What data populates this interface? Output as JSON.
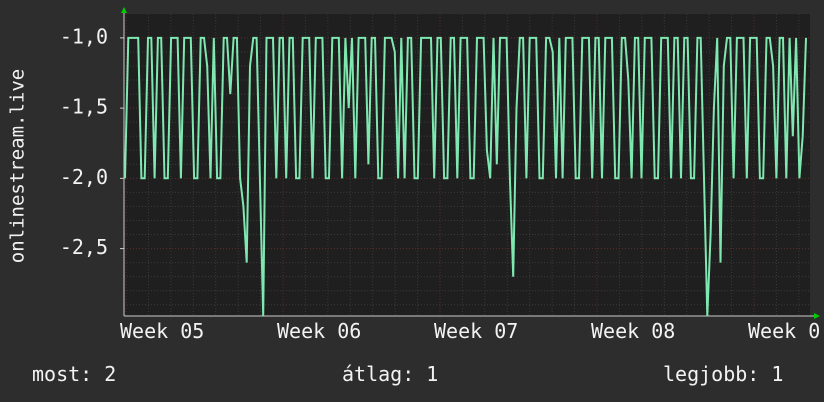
{
  "chart_data": {
    "type": "line",
    "ylabel": "onlinestream.live",
    "yticks": [
      "-1,0",
      "-1,5",
      "-2,0",
      "-2,5"
    ],
    "ytick_values": [
      -1.0,
      -1.5,
      -2.0,
      -2.5
    ],
    "xticks": [
      "Week 05",
      "Week 06",
      "Week 07",
      "Week 08",
      "Week 0"
    ],
    "ylim": [
      -2.98,
      -0.83
    ],
    "grid": true,
    "colors": {
      "background": "#2d2d2d",
      "plot": "#1f1f1f",
      "line": "#7ee8b0",
      "grid": "#5a2a2a",
      "axis": "#00cc00"
    },
    "series": [
      {
        "values": [
          -2,
          -1,
          -1,
          -1,
          -1,
          -2,
          -2,
          -1,
          -1,
          -2,
          -1,
          -1,
          -2,
          -2,
          -1,
          -1,
          -1,
          -2,
          -1,
          -1,
          -1,
          -2,
          -2,
          -1,
          -1,
          -1.2,
          -2,
          -1,
          -2,
          -2,
          -1,
          -1,
          -1.4,
          -1,
          -1,
          -2,
          -2.2,
          -2.6,
          -1.2,
          -1,
          -1,
          -2,
          -2.98,
          -1,
          -1,
          -1,
          -2,
          -1,
          -1,
          -2,
          -1,
          -1,
          -2,
          -2,
          -1,
          -1,
          -1,
          -2,
          -1,
          -1,
          -1,
          -2,
          -2,
          -1,
          -1,
          -1,
          -2,
          -1,
          -1.5,
          -1,
          -2,
          -1,
          -1,
          -1,
          -1.9,
          -1,
          -1,
          -2,
          -2,
          -1,
          -1,
          -1,
          -1.1,
          -2,
          -1,
          -2,
          -1,
          -1,
          -2,
          -2,
          -1,
          -1,
          -1,
          -1,
          -2,
          -1,
          -1,
          -2,
          -2,
          -1,
          -1,
          -2,
          -1,
          -1,
          -1,
          -2,
          -2,
          -1,
          -1,
          -1,
          -1.8,
          -2,
          -1,
          -1.9,
          -1,
          -1,
          -1,
          -2,
          -2.7,
          -1.5,
          -1,
          -1,
          -2,
          -1,
          -1,
          -1,
          -2,
          -2,
          -1,
          -1,
          -1.1,
          -2,
          -1,
          -2,
          -1,
          -1,
          -1,
          -2,
          -2,
          -1,
          -1,
          -1,
          -2,
          -1,
          -1,
          -2,
          -1,
          -1,
          -1,
          -2,
          -2,
          -1,
          -1,
          -1.3,
          -2,
          -1,
          -1,
          -2,
          -1,
          -1,
          -1,
          -2,
          -2,
          -1,
          -1,
          -1,
          -2,
          -1,
          -1,
          -2,
          -1,
          -1,
          -2,
          -2,
          -1,
          -1,
          -2,
          -2.98,
          -2.4,
          -1.5,
          -1,
          -2.6,
          -1.2,
          -1,
          -1,
          -2,
          -1,
          -1,
          -1,
          -2,
          -1,
          -1,
          -1,
          -2,
          -2,
          -1,
          -1,
          -1.2,
          -2,
          -1,
          -1,
          -2,
          -1,
          -1.7,
          -1,
          -2,
          -1.7,
          -1
        ],
        "x_start": "Week 05 -0.02",
        "x_note": ""
      }
    ]
  },
  "footer": {
    "current": "most: 2",
    "average": "átlag: 1",
    "best": "legjobb: 1"
  }
}
